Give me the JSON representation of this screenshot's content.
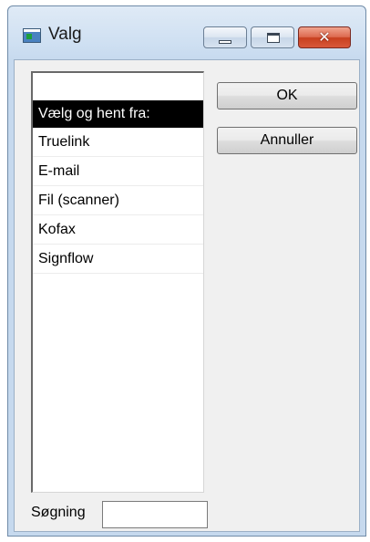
{
  "window": {
    "title": "Valg",
    "controls": {
      "minimize_icon": "minimize-icon",
      "maximize_icon": "maximize-icon",
      "close_icon": "close-icon",
      "close_glyph": "✕"
    }
  },
  "list": {
    "header": "Vælg og hent fra:",
    "items": [
      "Truelink",
      "E-mail",
      "Fil (scanner)",
      "Kofax",
      "Signflow"
    ]
  },
  "buttons": {
    "ok_label": "OK",
    "cancel_label": "Annuller"
  },
  "search": {
    "label": "Søgning",
    "value": ""
  },
  "colors": {
    "selection_bg": "#000000",
    "selection_fg": "#ffffff",
    "close_button": "#c8401f",
    "frame": "#c6d9ee"
  }
}
